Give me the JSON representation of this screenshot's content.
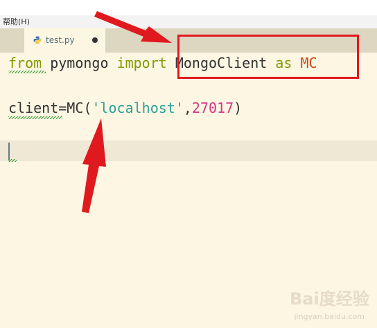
{
  "menubar": {
    "help_label": "帮助(H)"
  },
  "tab": {
    "filename": "test.py"
  },
  "code": {
    "line1": {
      "kw_from": "from",
      "module": " pymongo ",
      "kw_import": "import",
      "class_name": " MongoClient ",
      "kw_as": "as",
      "alias": " MC"
    },
    "line2": {
      "var": "client",
      "eq": "=",
      "call": "MC",
      "open": "(",
      "host": "'localhost'",
      "comma": ",",
      "port": "27017",
      "close": ")"
    }
  },
  "watermark": {
    "logo": "Bai度经验",
    "url": "jingyan.baidu.com"
  },
  "colors": {
    "annotation_red": "#e0191e",
    "keyword": "#859900",
    "string": "#2aa198",
    "number": "#d33682",
    "constant": "#cb4b16",
    "editor_bg": "#fdf6e3"
  }
}
